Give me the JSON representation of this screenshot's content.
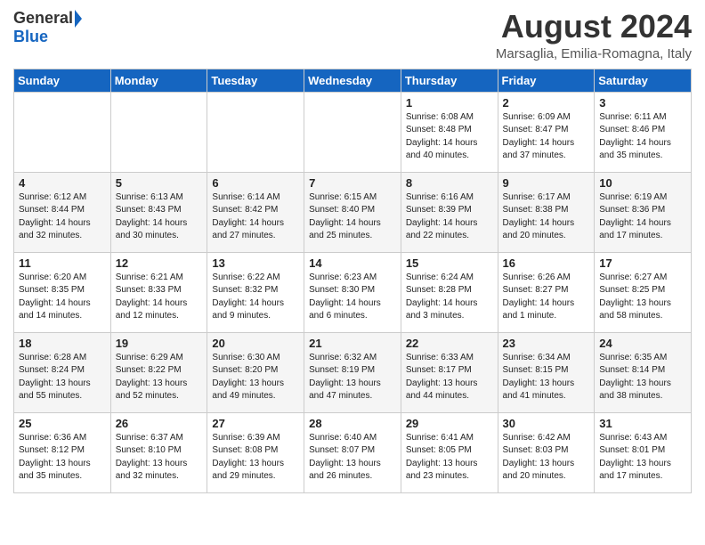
{
  "header": {
    "logo_general": "General",
    "logo_blue": "Blue",
    "month": "August 2024",
    "location": "Marsaglia, Emilia-Romagna, Italy"
  },
  "weekdays": [
    "Sunday",
    "Monday",
    "Tuesday",
    "Wednesday",
    "Thursday",
    "Friday",
    "Saturday"
  ],
  "weeks": [
    [
      {
        "day": "",
        "info": ""
      },
      {
        "day": "",
        "info": ""
      },
      {
        "day": "",
        "info": ""
      },
      {
        "day": "",
        "info": ""
      },
      {
        "day": "1",
        "info": "Sunrise: 6:08 AM\nSunset: 8:48 PM\nDaylight: 14 hours\nand 40 minutes."
      },
      {
        "day": "2",
        "info": "Sunrise: 6:09 AM\nSunset: 8:47 PM\nDaylight: 14 hours\nand 37 minutes."
      },
      {
        "day": "3",
        "info": "Sunrise: 6:11 AM\nSunset: 8:46 PM\nDaylight: 14 hours\nand 35 minutes."
      }
    ],
    [
      {
        "day": "4",
        "info": "Sunrise: 6:12 AM\nSunset: 8:44 PM\nDaylight: 14 hours\nand 32 minutes."
      },
      {
        "day": "5",
        "info": "Sunrise: 6:13 AM\nSunset: 8:43 PM\nDaylight: 14 hours\nand 30 minutes."
      },
      {
        "day": "6",
        "info": "Sunrise: 6:14 AM\nSunset: 8:42 PM\nDaylight: 14 hours\nand 27 minutes."
      },
      {
        "day": "7",
        "info": "Sunrise: 6:15 AM\nSunset: 8:40 PM\nDaylight: 14 hours\nand 25 minutes."
      },
      {
        "day": "8",
        "info": "Sunrise: 6:16 AM\nSunset: 8:39 PM\nDaylight: 14 hours\nand 22 minutes."
      },
      {
        "day": "9",
        "info": "Sunrise: 6:17 AM\nSunset: 8:38 PM\nDaylight: 14 hours\nand 20 minutes."
      },
      {
        "day": "10",
        "info": "Sunrise: 6:19 AM\nSunset: 8:36 PM\nDaylight: 14 hours\nand 17 minutes."
      }
    ],
    [
      {
        "day": "11",
        "info": "Sunrise: 6:20 AM\nSunset: 8:35 PM\nDaylight: 14 hours\nand 14 minutes."
      },
      {
        "day": "12",
        "info": "Sunrise: 6:21 AM\nSunset: 8:33 PM\nDaylight: 14 hours\nand 12 minutes."
      },
      {
        "day": "13",
        "info": "Sunrise: 6:22 AM\nSunset: 8:32 PM\nDaylight: 14 hours\nand 9 minutes."
      },
      {
        "day": "14",
        "info": "Sunrise: 6:23 AM\nSunset: 8:30 PM\nDaylight: 14 hours\nand 6 minutes."
      },
      {
        "day": "15",
        "info": "Sunrise: 6:24 AM\nSunset: 8:28 PM\nDaylight: 14 hours\nand 3 minutes."
      },
      {
        "day": "16",
        "info": "Sunrise: 6:26 AM\nSunset: 8:27 PM\nDaylight: 14 hours\nand 1 minute."
      },
      {
        "day": "17",
        "info": "Sunrise: 6:27 AM\nSunset: 8:25 PM\nDaylight: 13 hours\nand 58 minutes."
      }
    ],
    [
      {
        "day": "18",
        "info": "Sunrise: 6:28 AM\nSunset: 8:24 PM\nDaylight: 13 hours\nand 55 minutes."
      },
      {
        "day": "19",
        "info": "Sunrise: 6:29 AM\nSunset: 8:22 PM\nDaylight: 13 hours\nand 52 minutes."
      },
      {
        "day": "20",
        "info": "Sunrise: 6:30 AM\nSunset: 8:20 PM\nDaylight: 13 hours\nand 49 minutes."
      },
      {
        "day": "21",
        "info": "Sunrise: 6:32 AM\nSunset: 8:19 PM\nDaylight: 13 hours\nand 47 minutes."
      },
      {
        "day": "22",
        "info": "Sunrise: 6:33 AM\nSunset: 8:17 PM\nDaylight: 13 hours\nand 44 minutes."
      },
      {
        "day": "23",
        "info": "Sunrise: 6:34 AM\nSunset: 8:15 PM\nDaylight: 13 hours\nand 41 minutes."
      },
      {
        "day": "24",
        "info": "Sunrise: 6:35 AM\nSunset: 8:14 PM\nDaylight: 13 hours\nand 38 minutes."
      }
    ],
    [
      {
        "day": "25",
        "info": "Sunrise: 6:36 AM\nSunset: 8:12 PM\nDaylight: 13 hours\nand 35 minutes."
      },
      {
        "day": "26",
        "info": "Sunrise: 6:37 AM\nSunset: 8:10 PM\nDaylight: 13 hours\nand 32 minutes."
      },
      {
        "day": "27",
        "info": "Sunrise: 6:39 AM\nSunset: 8:08 PM\nDaylight: 13 hours\nand 29 minutes."
      },
      {
        "day": "28",
        "info": "Sunrise: 6:40 AM\nSunset: 8:07 PM\nDaylight: 13 hours\nand 26 minutes."
      },
      {
        "day": "29",
        "info": "Sunrise: 6:41 AM\nSunset: 8:05 PM\nDaylight: 13 hours\nand 23 minutes."
      },
      {
        "day": "30",
        "info": "Sunrise: 6:42 AM\nSunset: 8:03 PM\nDaylight: 13 hours\nand 20 minutes."
      },
      {
        "day": "31",
        "info": "Sunrise: 6:43 AM\nSunset: 8:01 PM\nDaylight: 13 hours\nand 17 minutes."
      }
    ]
  ]
}
